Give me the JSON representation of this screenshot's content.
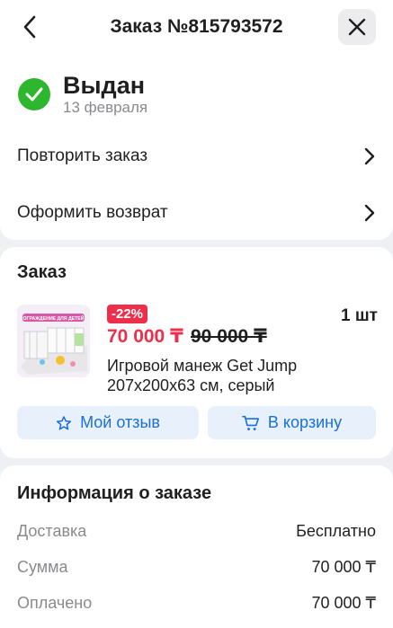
{
  "header": {
    "title": "Заказ №815793572",
    "back_icon": "chevron-left-icon",
    "close_icon": "close-icon"
  },
  "status": {
    "title": "Выдан",
    "date": "13 февраля",
    "icon": "check-circle-icon",
    "color": "#2eb62e"
  },
  "actions": [
    {
      "label": "Повторить заказ"
    },
    {
      "label": "Оформить возврат"
    }
  ],
  "order": {
    "section_title": "Заказ",
    "item": {
      "discount": "-22%",
      "price": "70 000 ₸",
      "old_price": "90 000 ₸",
      "quantity": "1 шт",
      "name": "Игровой манеж Get Jump 207x200x63 см, серый",
      "image_banner": "ОГРАЖДЕНИЕ ДЛЯ ДЕТЕЙ"
    },
    "review_button": "Мой отзыв",
    "cart_button": "В корзину"
  },
  "info": {
    "section_title": "Информация о заказе",
    "rows": [
      {
        "key": "Доставка",
        "value": "Бесплатно"
      },
      {
        "key": "Сумма",
        "value": "70 000 ₸"
      },
      {
        "key": "Оплачено",
        "value": "70 000 ₸"
      }
    ]
  },
  "colors": {
    "accent": "#1a6fd6",
    "discount": "#ee2f4b",
    "button_bg": "#e8f1fb",
    "background": "#eef0f4"
  }
}
